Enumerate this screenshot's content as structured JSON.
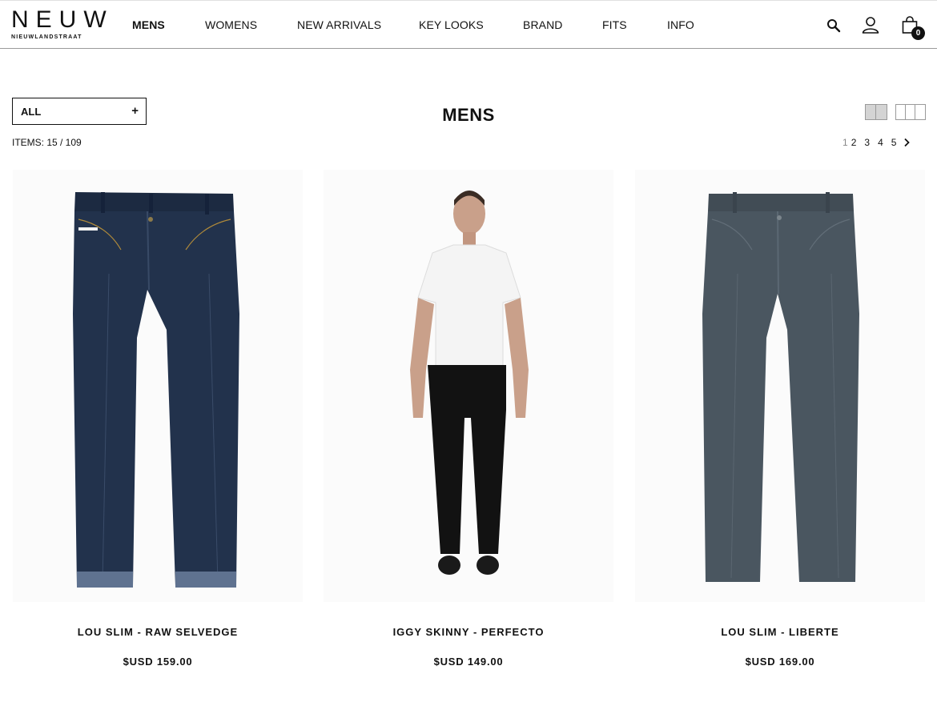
{
  "brand": {
    "name": "NEUW",
    "subtitle": "NIEUWLANDSTRAAT"
  },
  "nav": {
    "items": [
      {
        "label": "MENS",
        "active": true
      },
      {
        "label": "WOMENS",
        "active": false
      },
      {
        "label": "NEW ARRIVALS",
        "active": false
      },
      {
        "label": "KEY LOOKS",
        "active": false
      },
      {
        "label": "BRAND",
        "active": false
      },
      {
        "label": "FITS",
        "active": false
      },
      {
        "label": "INFO",
        "active": false
      }
    ]
  },
  "header_icons": {
    "search": "search-icon",
    "account": "user-icon",
    "cart": "shopping-bag-icon",
    "cart_count": "0"
  },
  "filter": {
    "selected": "ALL",
    "expand_symbol": "+"
  },
  "page": {
    "title": "MENS",
    "items_count": "ITEMS: 15 / 109"
  },
  "view_toggles": [
    "two-column-grid-icon",
    "three-column-grid-icon"
  ],
  "pagination": {
    "current": "1",
    "pages": [
      "2",
      "3",
      "4",
      "5"
    ],
    "next_icon": "chevron-right-icon"
  },
  "products": [
    {
      "name": "LOU SLIM - RAW SELVEDGE",
      "price": "$USD 159.00",
      "image": "dark-raw-denim-jeans"
    },
    {
      "name": "IGGY SKINNY - PERFECTO",
      "price": "$USD 149.00",
      "image": "model-white-tee-black-jeans"
    },
    {
      "name": "LOU SLIM - LIBERTE",
      "price": "$USD 169.00",
      "image": "grey-denim-jeans"
    }
  ],
  "colors": {
    "text": "#111111",
    "header_border": "#9a9a9a",
    "raw_denim": "#1f2d44",
    "grey_denim": "#4a5660",
    "black_denim": "#121212"
  }
}
